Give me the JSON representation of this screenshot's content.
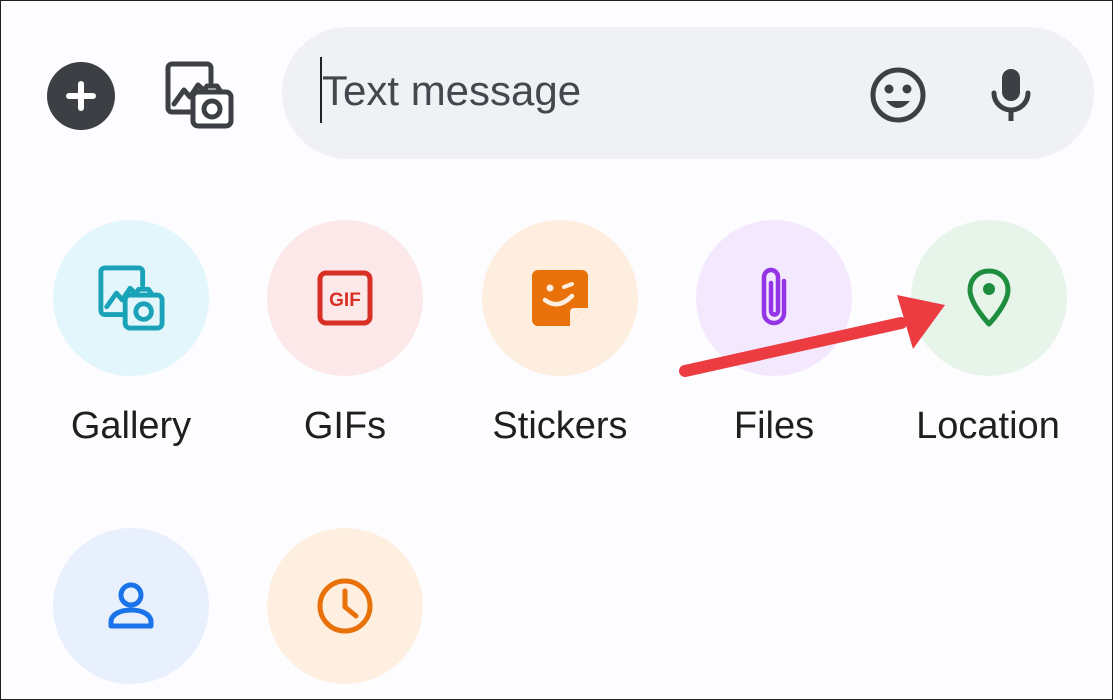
{
  "compose": {
    "placeholder": "Text message"
  },
  "icons": {
    "add": "plus-icon",
    "gallery_quick": "gallery-icon",
    "emoji": "emoji-icon",
    "mic": "mic-icon",
    "annotation": "red-arrow"
  },
  "attachments": [
    {
      "label": "Gallery",
      "icon": "gallery-icon",
      "bg": "#e3f6fb",
      "color": "#1aa3b8"
    },
    {
      "label": "GIFs",
      "icon": "gif-icon",
      "bg": "#fce8e8",
      "color": "#d93025"
    },
    {
      "label": "Stickers",
      "icon": "sticker-icon",
      "bg": "#feeee0",
      "color": "#e8710a"
    },
    {
      "label": "Files",
      "icon": "paperclip-icon",
      "bg": "#f3e8fd",
      "color": "#9334e6"
    },
    {
      "label": "Location",
      "icon": "location-pin-icon",
      "bg": "#e6f4ea",
      "color": "#1e8e3e"
    },
    {
      "label": "",
      "icon": "contact-icon",
      "bg": "#e8f0fe",
      "color": "#1a73e8"
    },
    {
      "label": "",
      "icon": "clock-icon",
      "bg": "#feefe0",
      "color": "#e8710a"
    }
  ],
  "colors": {
    "arrow": "#ec3c42",
    "dark_button": "#3c3f43",
    "compose_bg": "#f0f1f5"
  }
}
